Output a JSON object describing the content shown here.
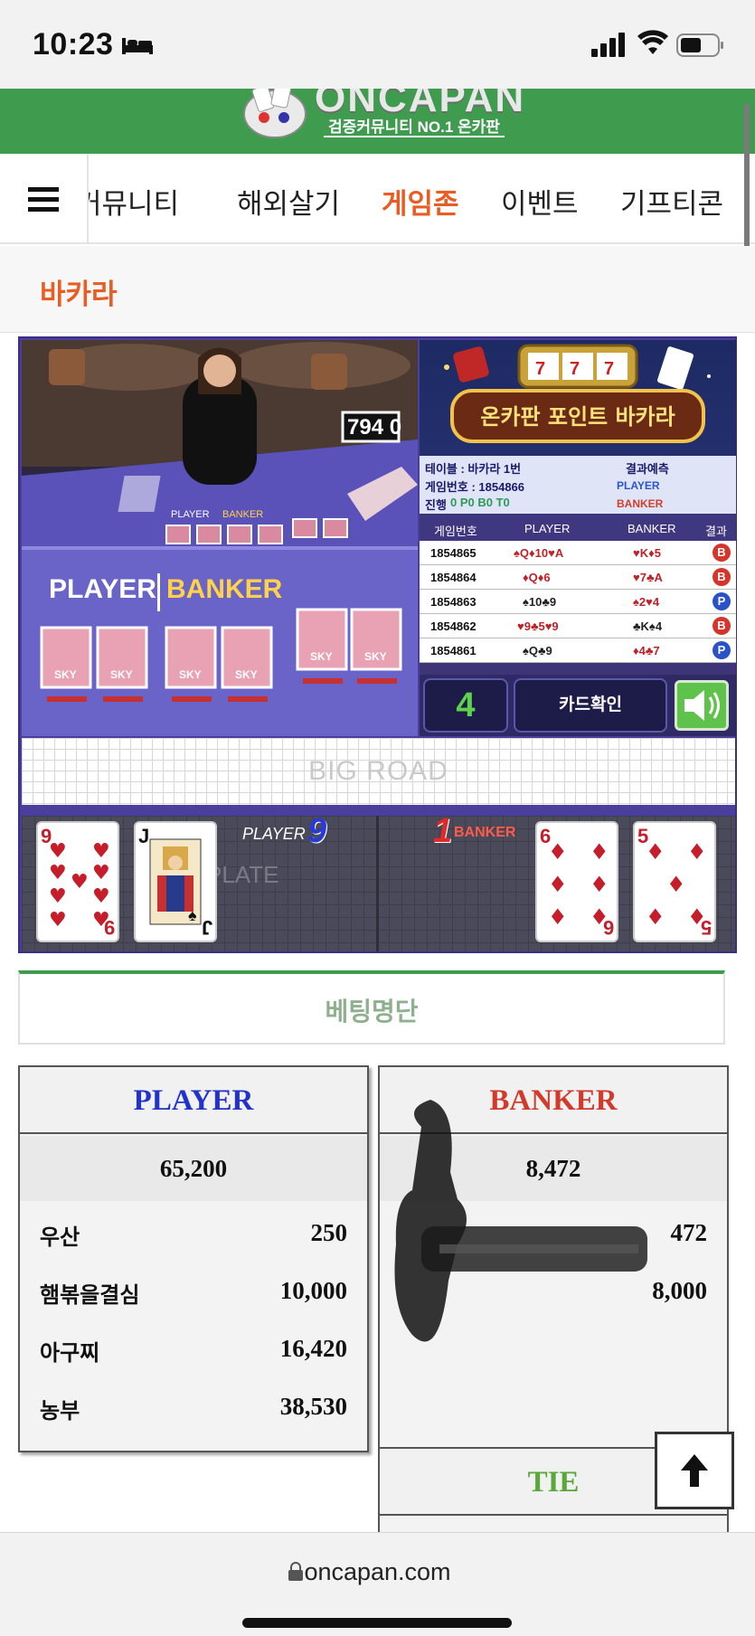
{
  "status_bar": {
    "time": "10:23"
  },
  "logo": {
    "brand": "ONCAPAN",
    "tagline": "검증커뮤니티 NO.1 온카판"
  },
  "nav": {
    "items": [
      "커뮤니티",
      "해외살기",
      "게임존",
      "이벤트",
      "기프티콘"
    ],
    "active": "게임존"
  },
  "page_title": "바카라",
  "game": {
    "video": {
      "table_sign": "794 0",
      "layout_player": "PLAYER",
      "layout_banker": "BANKER",
      "card_brand": "SKY"
    },
    "banner": {
      "title": "온카판 포인트 바카라"
    },
    "info": {
      "table_label": "테이블 : 바카라 1번",
      "game_no_label": "게임번호 : 1854866",
      "progress_label": "진행",
      "progress_values": "0  P0  B0  T0",
      "prediction_label": "결과예측",
      "prediction_player": "PLAYER",
      "prediction_banker": "BANKER"
    },
    "history": {
      "headers": [
        "게임번호",
        "PLAYER",
        "BANKER",
        "결과"
      ],
      "rows": [
        {
          "no": "1854865",
          "player": "♠Q♦10♥A",
          "banker": "♥K♦5",
          "result": "B"
        },
        {
          "no": "1854864",
          "player": "♦Q♦6",
          "banker": "♥7♣A",
          "result": "B"
        },
        {
          "no": "1854863",
          "player": "♠10♣9",
          "banker": "♠2♥4",
          "result": "P"
        },
        {
          "no": "1854862",
          "player": "♥9♣5♥9",
          "banker": "♣K♠4",
          "result": "B"
        },
        {
          "no": "1854861",
          "player": "♠Q♣9",
          "banker": "♦4♣7",
          "result": "P"
        }
      ]
    },
    "controls": {
      "countdown": "4",
      "card_check": "카드확인"
    },
    "big_road": "BIG ROAD",
    "watermark": "PLATE",
    "player_label": "PLAYER",
    "player_score": "9",
    "banker_label": "BANKER",
    "banker_score": "1",
    "player_cards": [
      {
        "rank": "9",
        "suit": "♥"
      },
      {
        "rank": "J",
        "suit": "♠"
      }
    ],
    "banker_cards": [
      {
        "rank": "6",
        "suit": "♦"
      },
      {
        "rank": "5",
        "suit": "♦"
      }
    ]
  },
  "betting": {
    "header": "베팅명단",
    "player": {
      "title": "PLAYER",
      "total": "65,200",
      "rows": [
        {
          "name": "우산",
          "amount": "250"
        },
        {
          "name": "햄볶을결심",
          "amount": "10,000"
        },
        {
          "name": "아구찌",
          "amount": "16,420"
        },
        {
          "name": "농부",
          "amount": "38,530"
        }
      ]
    },
    "banker": {
      "title": "BANKER",
      "total": "8,472",
      "rows": [
        {
          "name": "",
          "amount": "472"
        },
        {
          "name": "",
          "amount": "8,000"
        }
      ]
    },
    "tie": {
      "title": "TIE"
    }
  },
  "url_bar": {
    "url": "oncapan.com"
  },
  "colors": {
    "green": "#3f9b4e",
    "accent_orange": "#e85d23",
    "player_blue": "#2233cc",
    "banker_red": "#d23b2b",
    "tie_green": "#5aa83a"
  }
}
